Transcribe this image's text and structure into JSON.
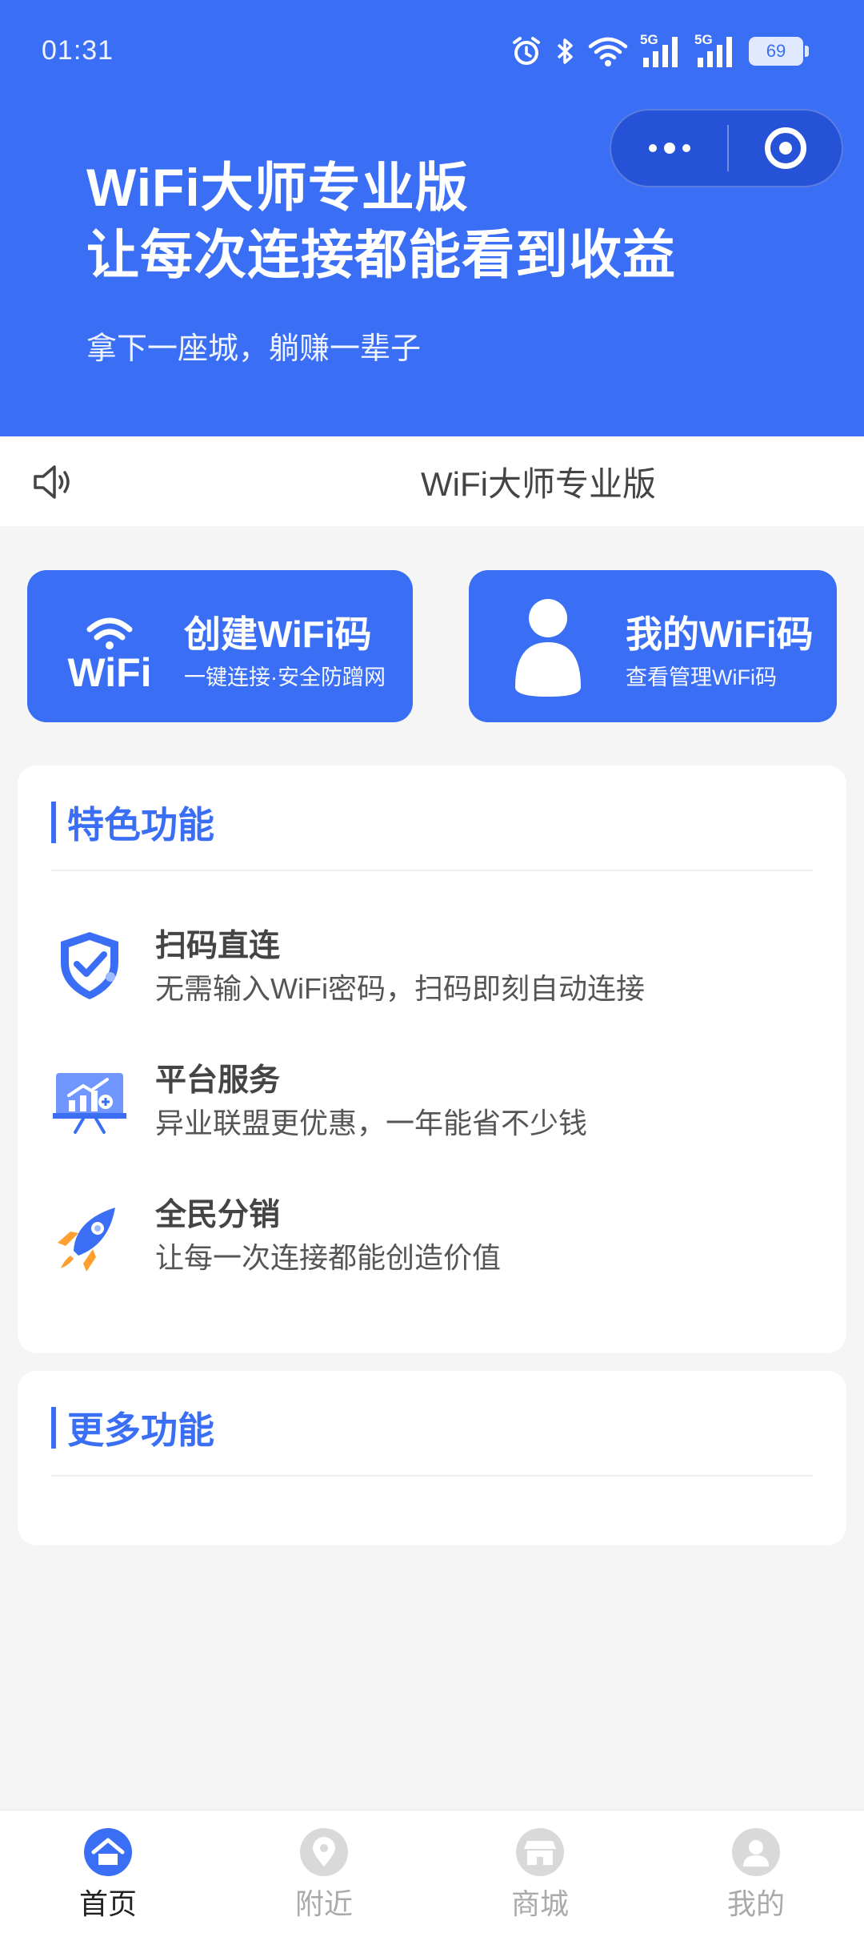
{
  "status_bar": {
    "time": "01:31",
    "network_1": "5G",
    "network_2": "5G",
    "battery": "69"
  },
  "mini_program_capsule": {
    "more_icon": "more-dots-icon",
    "close_icon": "close-circle-icon"
  },
  "hero": {
    "title_line1": "WiFi大师专业版",
    "title_line2": "让每次连接都能看到收益",
    "subtitle": "拿下一座城，躺赚一辈子",
    "background_color": "#3a6ef5"
  },
  "notice": {
    "icon": "speaker-icon",
    "text": "WiFi大师专业版"
  },
  "actions": [
    {
      "icon": "wifi-logo-icon",
      "title": "创建WiFi码",
      "description": "一键连接·安全防蹭网"
    },
    {
      "icon": "user-icon",
      "title": "我的WiFi码",
      "description": "查看管理WiFi码"
    }
  ],
  "features_section": {
    "title": "特色功能",
    "items": [
      {
        "icon": "shield-check-icon",
        "title": "扫码直连",
        "description": "无需输入WiFi密码，扫码即刻自动连接"
      },
      {
        "icon": "chart-board-icon",
        "title": "平台服务",
        "description": "异业联盟更优惠，一年能省不少钱"
      },
      {
        "icon": "rocket-icon",
        "title": "全民分销",
        "description": "让每一次连接都能创造价值"
      }
    ]
  },
  "more_section": {
    "title": "更多功能"
  },
  "tabbar": {
    "active_color": "#3a6ef5",
    "tabs": [
      {
        "icon": "home-icon",
        "label": "首页",
        "active": true
      },
      {
        "icon": "location-icon",
        "label": "附近",
        "active": false
      },
      {
        "icon": "shop-icon",
        "label": "商城",
        "active": false
      },
      {
        "icon": "profile-icon",
        "label": "我的",
        "active": false
      }
    ]
  }
}
